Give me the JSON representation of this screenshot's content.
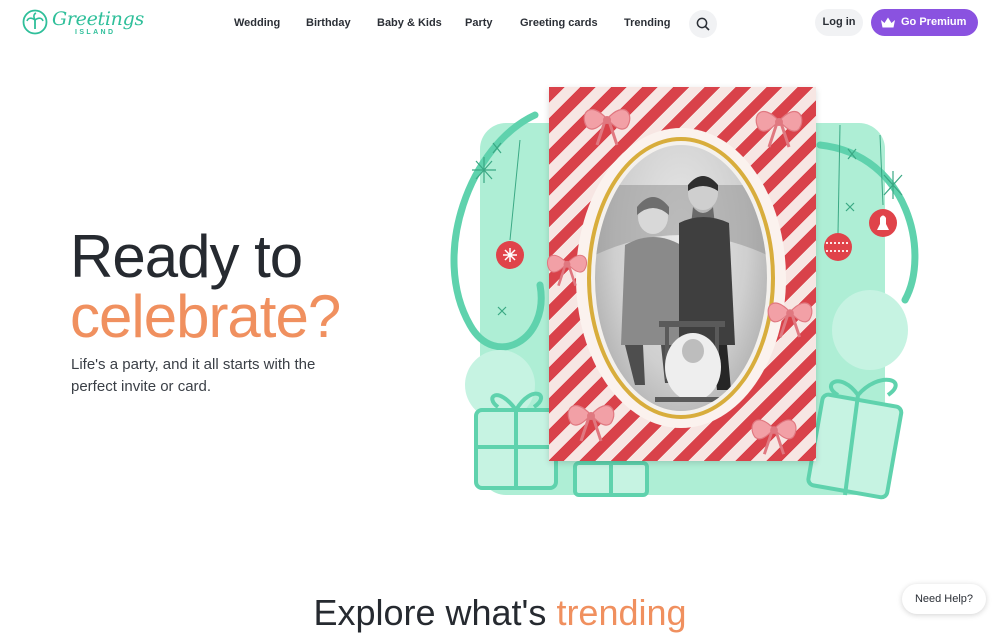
{
  "brand": {
    "name": "Greetings",
    "sub": "ISLAND",
    "color": "#2fbf9a"
  },
  "nav": {
    "items": [
      {
        "label": "Wedding"
      },
      {
        "label": "Birthday"
      },
      {
        "label": "Baby & Kids"
      },
      {
        "label": "Party"
      },
      {
        "label": "Greeting cards"
      },
      {
        "label": "Trending"
      }
    ],
    "search_icon": "search-icon"
  },
  "account": {
    "login_label": "Log in",
    "premium_label": "Go Premium",
    "premium_icon": "crown-icon",
    "premium_color": "#8a52e0"
  },
  "hero": {
    "title_line1": "Ready to",
    "title_line2": "celebrate?",
    "accent_color": "#f0905f",
    "subtitle": "Life's a party, and it all starts with the perfect invite or card."
  },
  "section": {
    "title_main": "Explore what's",
    "title_accent": "trending"
  },
  "help": {
    "label": "Need Help?"
  },
  "illustration": {
    "background_color": "#aeeed5",
    "card_colors": [
      "#d9424a",
      "#f7e6e3",
      "#d8ad3c"
    ]
  }
}
